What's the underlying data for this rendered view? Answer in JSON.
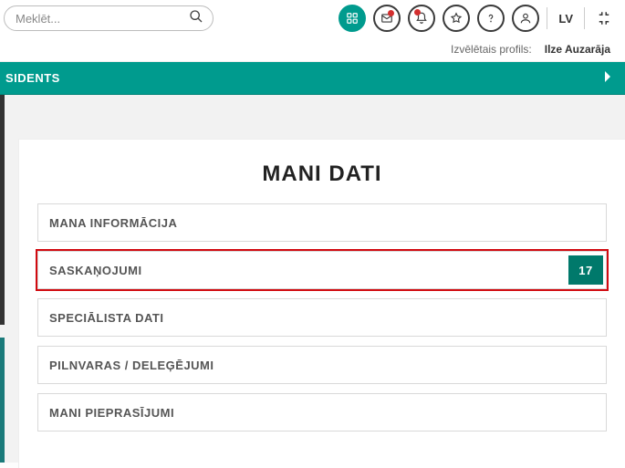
{
  "header": {
    "search_placeholder": "Meklēt...",
    "lang": "LV"
  },
  "profile": {
    "label": "Izvēlētais profils:",
    "name": "Ilze Auzarāja"
  },
  "greenbar": {
    "text": "SIDENTS"
  },
  "card": {
    "title": "MANI DATI",
    "items": [
      {
        "label": "MANA INFORMĀCIJA"
      },
      {
        "label": "SASKAŅOJUMI",
        "badge": "17"
      },
      {
        "label": "SPECIĀLISTA DATI"
      },
      {
        "label": "PILNVARAS / DELEĢĒJUMI"
      },
      {
        "label": "MANI PIEPRASĪJUMI"
      }
    ]
  }
}
